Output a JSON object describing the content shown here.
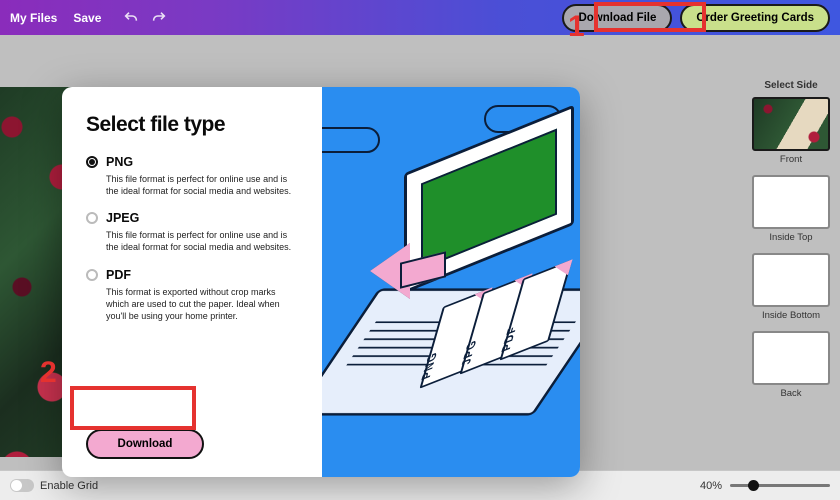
{
  "topbar": {
    "my_files": "My Files",
    "save": "Save",
    "download_file": "Download File",
    "order_cards": "Order Greeting Cards"
  },
  "annotations": {
    "n1": "1",
    "n2": "2"
  },
  "sidepanel": {
    "title": "Select Side",
    "front": "Front",
    "inside_top": "Inside Top",
    "inside_bottom": "Inside Bottom",
    "back": "Back"
  },
  "modal": {
    "title": "Select file type",
    "options": [
      {
        "name": "PNG",
        "desc": "This file format is perfect for online use and is the ideal format for social media and websites.",
        "selected": true
      },
      {
        "name": "JPEG",
        "desc": "This file format is perfect for online use and is the ideal format for social media and websites.",
        "selected": false
      },
      {
        "name": "PDF",
        "desc": "This format is exported without crop marks which are used to cut the paper. Ideal when you'll be using your home printer.",
        "selected": false
      }
    ],
    "download": "Download",
    "illu_docs": [
      "PNG",
      "JPG",
      "PDF"
    ]
  },
  "bottombar": {
    "enable_grid": "Enable Grid",
    "zoom": "40%"
  }
}
